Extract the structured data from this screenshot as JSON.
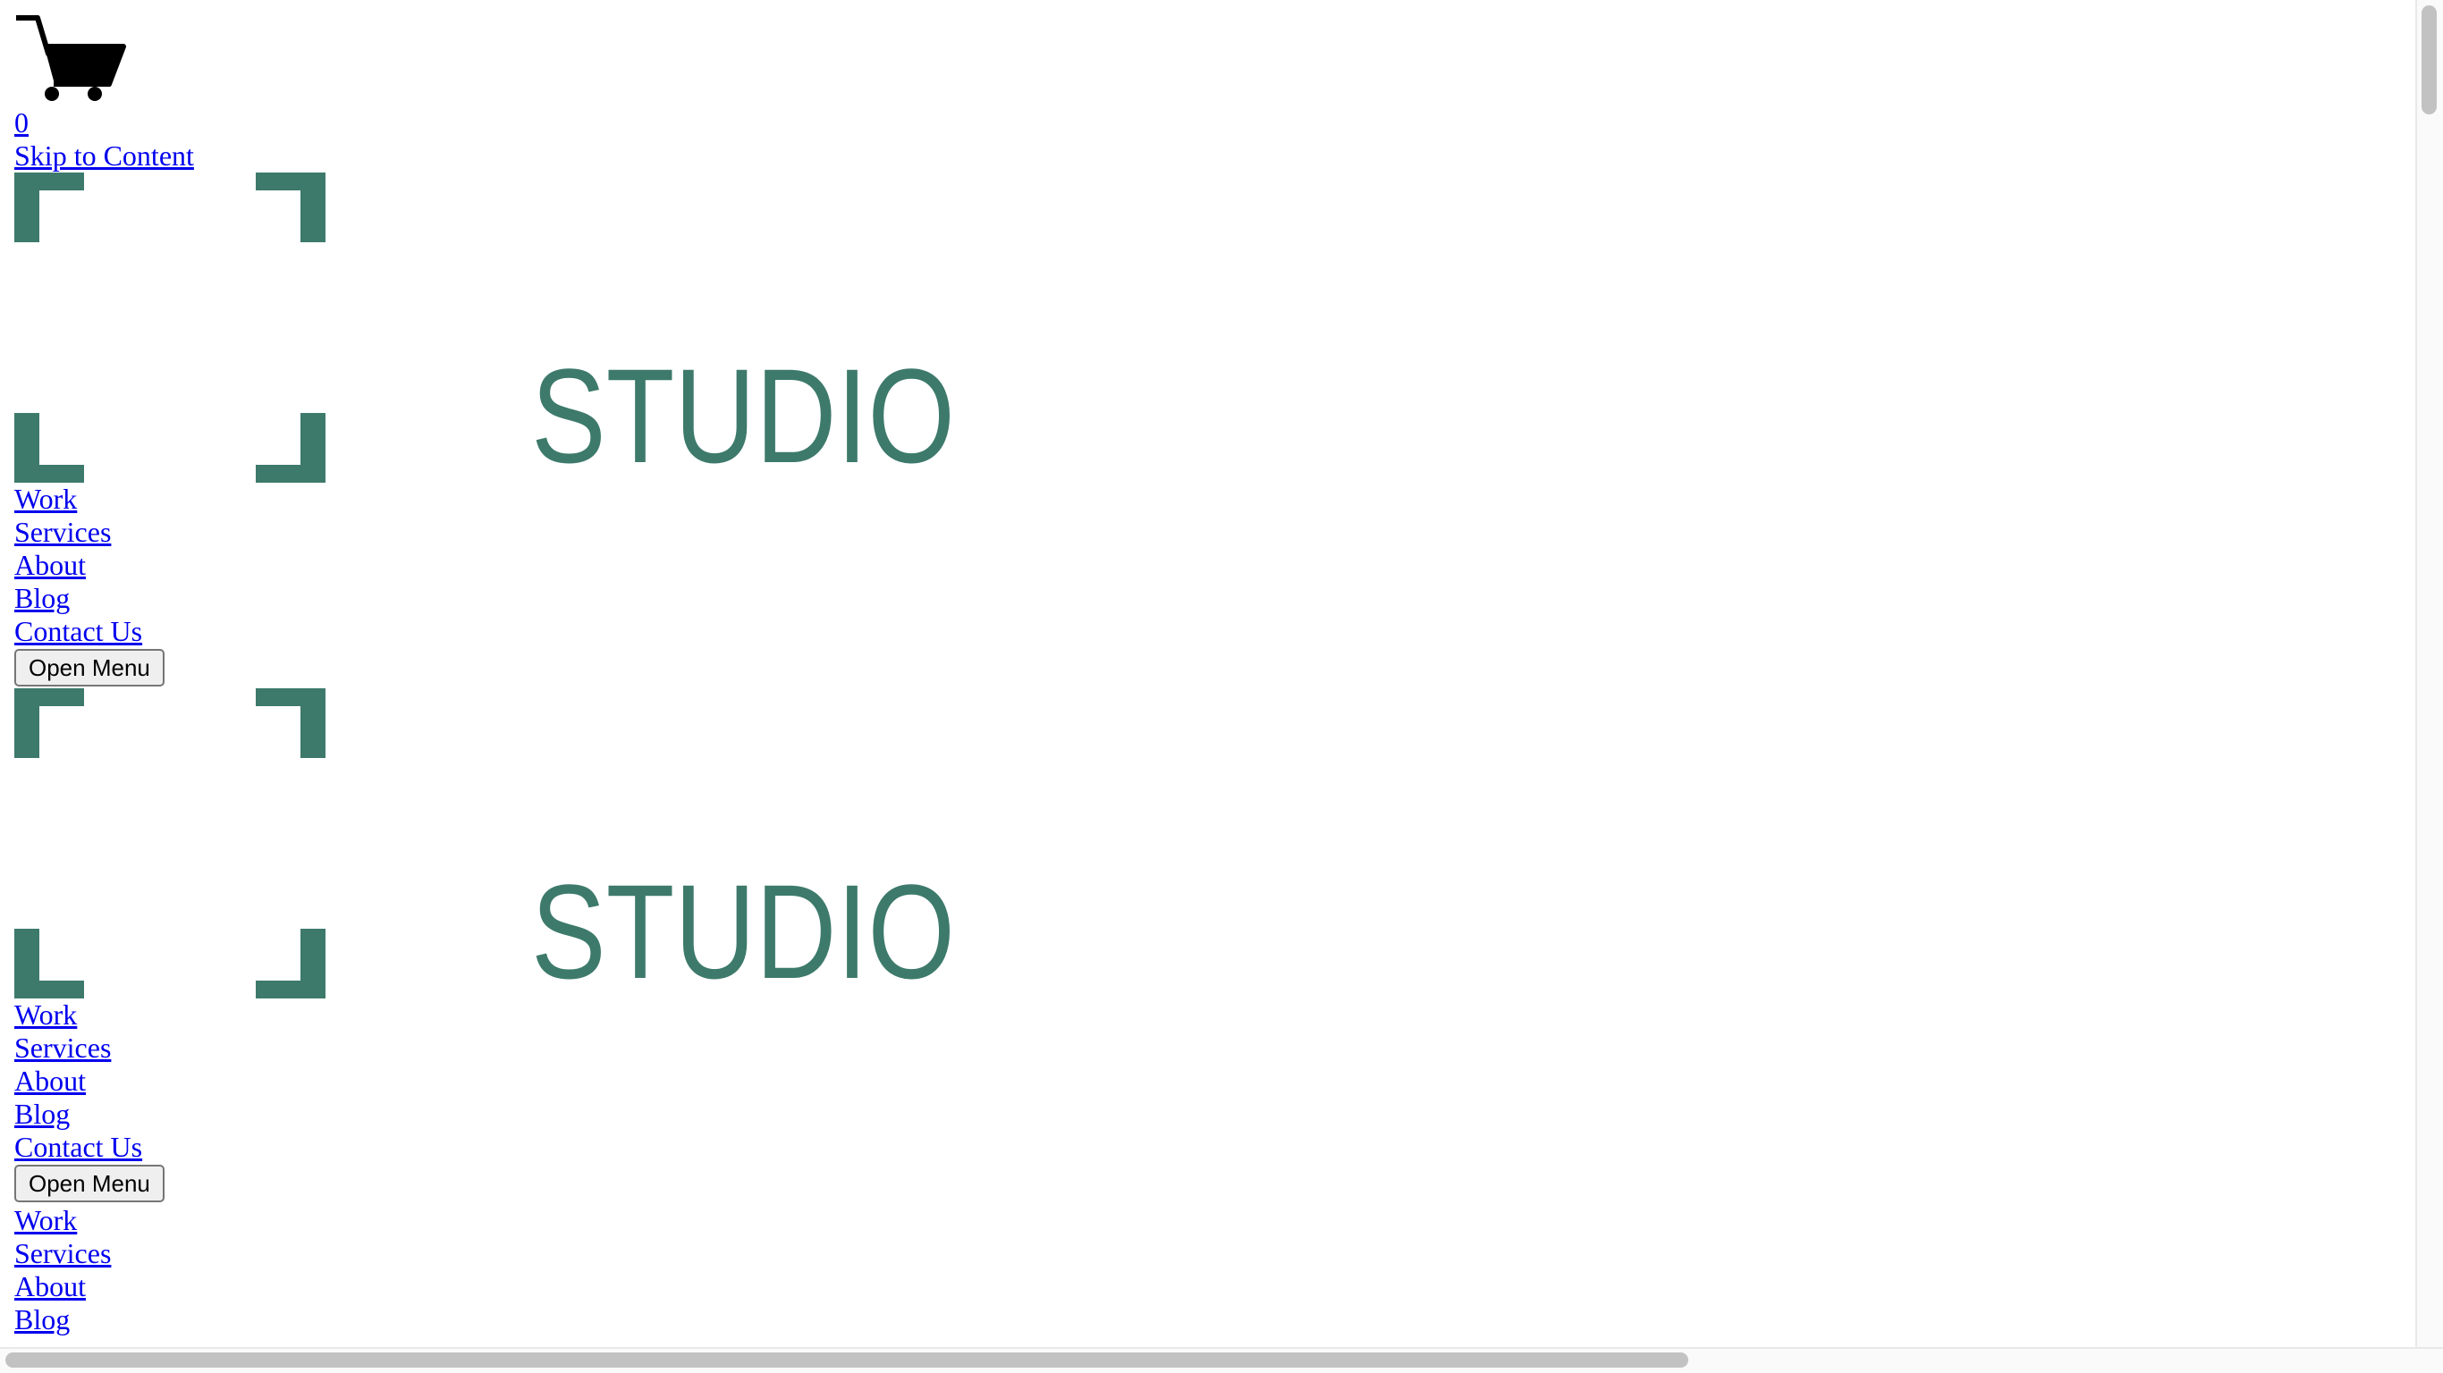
{
  "colors": {
    "logo": "#3d7a6b",
    "link": "#0000ee"
  },
  "cart": {
    "icon": "cart-icon",
    "count": "0"
  },
  "skip_link": "Skip to Content",
  "logo": {
    "text": "STUDIO"
  },
  "header": {
    "nav": [
      "Work",
      "Services",
      "About",
      "Blog",
      "Contact Us"
    ],
    "menu_button": "Open Menu"
  },
  "header_duplicate": {
    "nav": [
      "Work",
      "Services",
      "About",
      "Blog",
      "Contact Us"
    ],
    "menu_button": "Open Menu"
  },
  "mobile_nav": [
    "Work",
    "Services",
    "About",
    "Blog"
  ]
}
